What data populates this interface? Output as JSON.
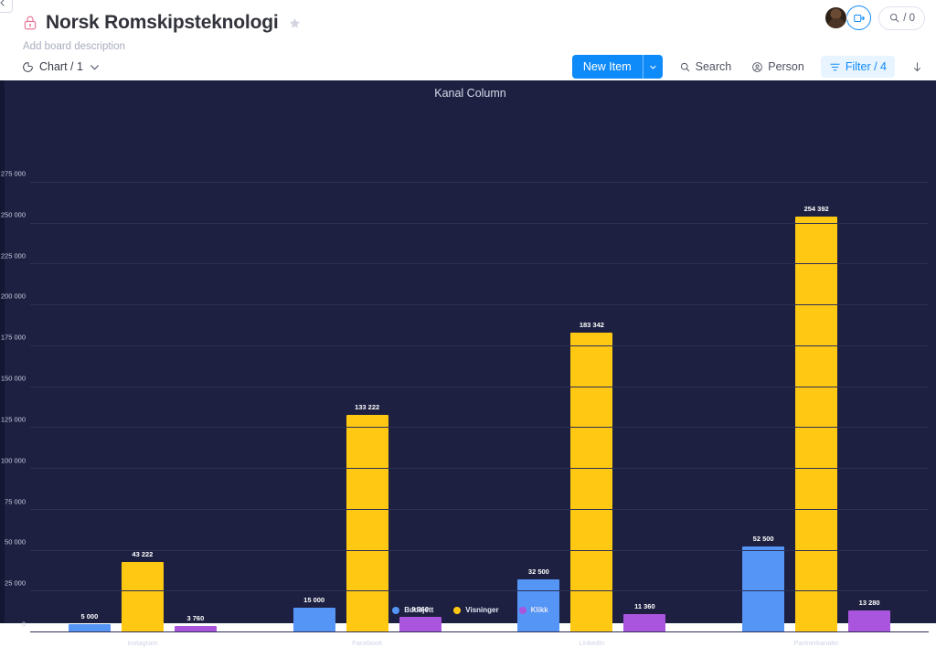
{
  "header": {
    "collapse_icon": "chevron-left-icon",
    "lock_icon": "lock-icon",
    "board_title": "Norsk Romskipsteknologi",
    "star_icon": "star-icon",
    "board_description": "Add board description",
    "avatar_name": "user-avatar",
    "invite_icon": "invite-members-icon",
    "activity_icon": "activity-log-icon",
    "activity_count": "/ 0"
  },
  "toolbar": {
    "view_icon": "chart-view-icon",
    "view_label": "Chart / 1",
    "view_caret": "chevron-down-icon",
    "new_item_label": "New Item",
    "new_item_caret": "chevron-down-icon",
    "search_icon": "search-icon",
    "search_label": "Search",
    "person_icon": "person-icon",
    "person_label": "Person",
    "filter_icon": "filter-icon",
    "filter_label": "Filter / 4",
    "sort_icon": "sort-descending-icon"
  },
  "colors": {
    "panel_bg": "#1d2040",
    "grid": "#2c3057",
    "series_budsjett": "#5595f5",
    "series_visninger": "#ffc812",
    "series_klikk": "#aa55dd",
    "accent_blue": "#0f8af9",
    "lock_pink": "#e97598"
  },
  "chart_data": {
    "type": "bar",
    "title": "Kanal Column",
    "xlabel": "",
    "ylabel": "",
    "ylim": [
      0,
      275000
    ],
    "grid": true,
    "legend_position": "bottom",
    "y_ticks": [
      "0",
      "25 000",
      "50 000",
      "75 000",
      "100 000",
      "125 000",
      "150 000",
      "175 000",
      "200 000",
      "225 000",
      "250 000",
      "275 000"
    ],
    "y_tick_values": [
      0,
      25000,
      50000,
      75000,
      100000,
      125000,
      150000,
      175000,
      200000,
      225000,
      250000,
      275000
    ],
    "categories": [
      "Instagram",
      "Facebook",
      "LinkedIn",
      "Partnerkanaler"
    ],
    "series": [
      {
        "name": "Budsjett",
        "color": "#5595f5",
        "values": [
          5000,
          15000,
          32500,
          52500
        ],
        "labels": [
          "5 000",
          "15 000",
          "32 500",
          "52 500"
        ]
      },
      {
        "name": "Visninger",
        "color": "#ffc812",
        "values": [
          43222,
          133222,
          183342,
          254392
        ],
        "labels": [
          "43 222",
          "133 222",
          "183 342",
          "254 392"
        ]
      },
      {
        "name": "Klikk",
        "color": "#aa55dd",
        "values": [
          3760,
          9360,
          11360,
          13280
        ],
        "labels": [
          "3 760",
          "9 360",
          "11 360",
          "13 280"
        ]
      }
    ]
  }
}
